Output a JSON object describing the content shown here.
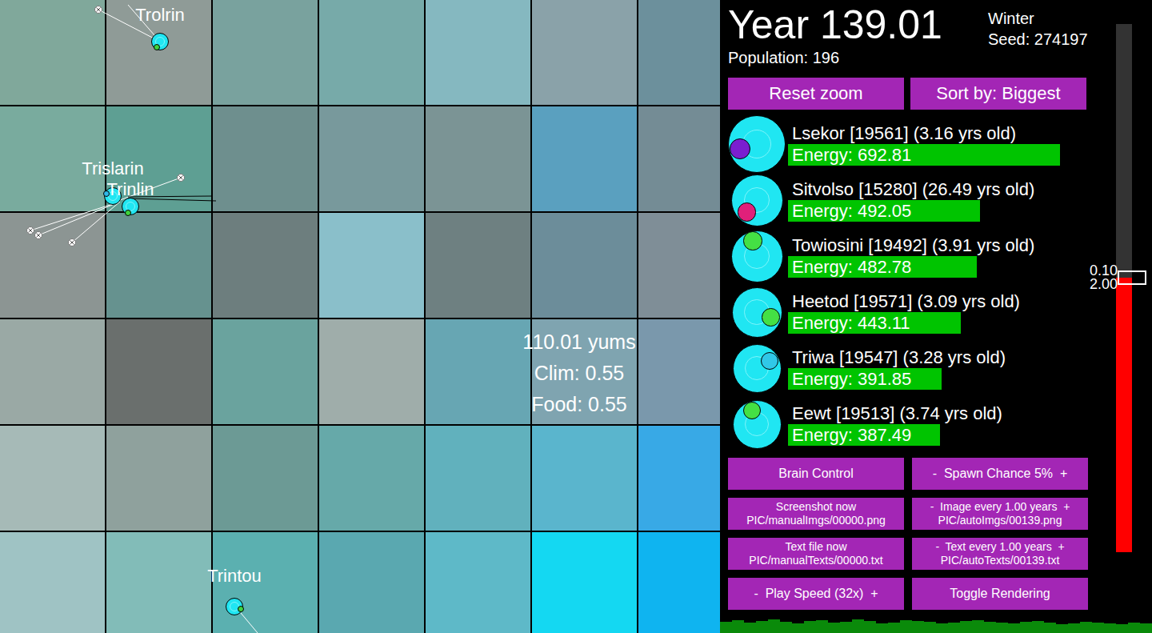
{
  "map": {
    "tiles": [
      [
        "#80a89b",
        "#8f9b97",
        "#79a29e",
        "#77aaa9",
        "#85b8c0",
        "#8aa2a9",
        "#6c909c"
      ],
      [
        "#79ab9e",
        "#5e9f93",
        "#6e8f8e",
        "#78999c",
        "#7b9495",
        "#5aa0bf",
        "#748c95"
      ],
      [
        "#8c9593",
        "#66928f",
        "#6d7e7e",
        "#8abfca",
        "#6e8081",
        "#6c8d9a",
        "#7f8e97"
      ],
      [
        "#9aa9a5",
        "#6a6f6d",
        "#6aa39e",
        "#9fadaa",
        "#67a6b3",
        "#7fa4b0",
        "#7a98ac"
      ],
      [
        "#a6bab7",
        "#8fa19d",
        "#6c9a95",
        "#66a9a9",
        "#61b1bd",
        "#5ab5cd",
        "#38a9e6"
      ],
      [
        "#9fc3c4",
        "#82bcb8",
        "#5bb0b0",
        "#5aa8b0",
        "#5eb9c8",
        "#14d8f2",
        "#0fb4f0"
      ]
    ],
    "tile_info": [
      "110.01 yums",
      "Clim: 0.55",
      "Food: 0.55"
    ],
    "creatures": [
      {
        "name": "Trolrin",
        "color": "#3ed43e",
        "heading": 120
      },
      {
        "name": "Trislarin",
        "color": "#30b8e8",
        "heading": 200
      },
      {
        "name": "Trinlin",
        "color": "#3ed43e",
        "heading": 110
      },
      {
        "name": "Trintou",
        "color": "#3ed43e",
        "heading": 20
      }
    ]
  },
  "header": {
    "year": "Year 139.01",
    "population": "Population: 196",
    "season": "Winter",
    "seed": "Seed: 274197"
  },
  "top_buttons": [
    "Reset zoom",
    "Sort by: Biggest"
  ],
  "ranking": [
    {
      "name": "Lsekor [19561] (3.16 yrs old)",
      "energy": "Energy: 692.81",
      "level": 0.85,
      "color": "#7a1fd0",
      "heading": 165
    },
    {
      "name": "Sitvolso [15280] (26.49 yrs old)",
      "energy": "Energy: 492.05",
      "level": 0.6,
      "color": "#e0207a",
      "heading": 130
    },
    {
      "name": "Towiosini [19492] (3.91 yrs old)",
      "energy": "Energy: 482.78",
      "level": 0.59,
      "color": "#44e044",
      "heading": 255
    },
    {
      "name": "Heetod [19571] (3.09 yrs old)",
      "energy": "Energy: 443.11",
      "level": 0.54,
      "color": "#44e044",
      "heading": 20
    },
    {
      "name": "Triwa [19547] (3.28 yrs old)",
      "energy": "Energy: 391.85",
      "level": 0.48,
      "color": "#30c8e8",
      "heading": 330
    },
    {
      "name": "Eewt [19513] (3.74 yrs old)",
      "energy": "Energy: 387.49",
      "level": 0.475,
      "color": "#44e044",
      "heading": 250
    }
  ],
  "controls": [
    {
      "lines": [
        "Brain Control"
      ]
    },
    {
      "lines": [
        "-  Spawn Chance 5%  +"
      ]
    },
    {
      "lines": [
        "Screenshot now",
        "PIC/manualImgs/00000.png"
      ]
    },
    {
      "lines": [
        "-  Image every 1.00 years  +",
        "PIC/autoImgs/00139.png"
      ]
    },
    {
      "lines": [
        "Text file now",
        "PIC/manualTexts/00000.txt"
      ]
    },
    {
      "lines": [
        "-  Text every 1.00 years  +",
        "PIC/autoTexts/00139.txt"
      ]
    },
    {
      "lines": [
        "-  Play Speed (32x)  +"
      ]
    },
    {
      "lines": [
        "Toggle Rendering"
      ]
    }
  ],
  "slider": {
    "labels": [
      "0.10",
      "2.00"
    ],
    "level": 0.52
  },
  "population_graph": {
    "values": [
      14,
      16,
      13,
      15,
      17,
      14,
      12,
      15,
      16,
      13,
      14,
      17,
      15,
      12,
      13,
      16,
      15,
      14,
      12,
      13,
      15,
      16,
      14,
      13,
      12,
      14,
      15,
      13,
      11,
      12,
      14,
      13,
      12,
      11,
      13,
      12
    ]
  }
}
